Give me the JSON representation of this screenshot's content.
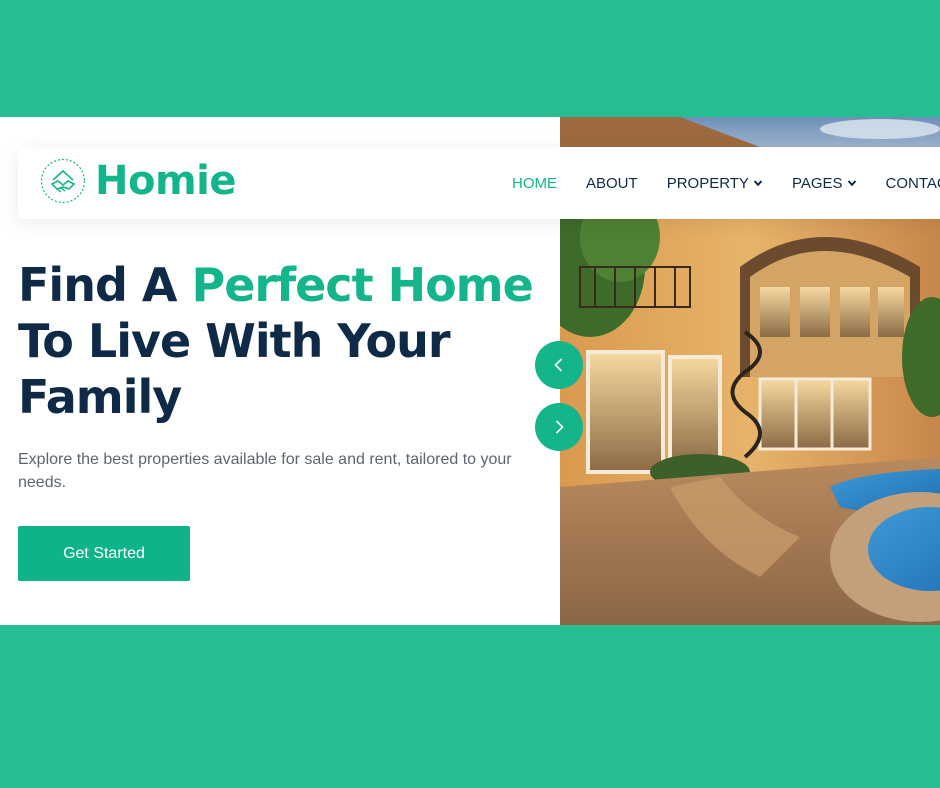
{
  "brand": {
    "name": "Homie"
  },
  "nav": {
    "items": [
      {
        "label": "HOME",
        "active": true,
        "dropdown": false
      },
      {
        "label": "ABOUT",
        "active": false,
        "dropdown": false
      },
      {
        "label": "PROPERTY",
        "active": false,
        "dropdown": true
      },
      {
        "label": "PAGES",
        "active": false,
        "dropdown": true
      },
      {
        "label": "CONTACT",
        "active": false,
        "dropdown": false
      }
    ]
  },
  "hero": {
    "title_part1": "Find A ",
    "title_accent": "Perfect Home",
    "title_part2": "To Live With Your Family",
    "description": "Explore the best properties available for sale and rent, tailored to your needs.",
    "cta_label": "Get Started"
  },
  "slider": {
    "prev_icon": "chevron-left-icon",
    "next_icon": "chevron-right-icon"
  },
  "colors": {
    "accent": "#14B58A",
    "background": "#27BD93",
    "heading": "#0E2A47"
  }
}
